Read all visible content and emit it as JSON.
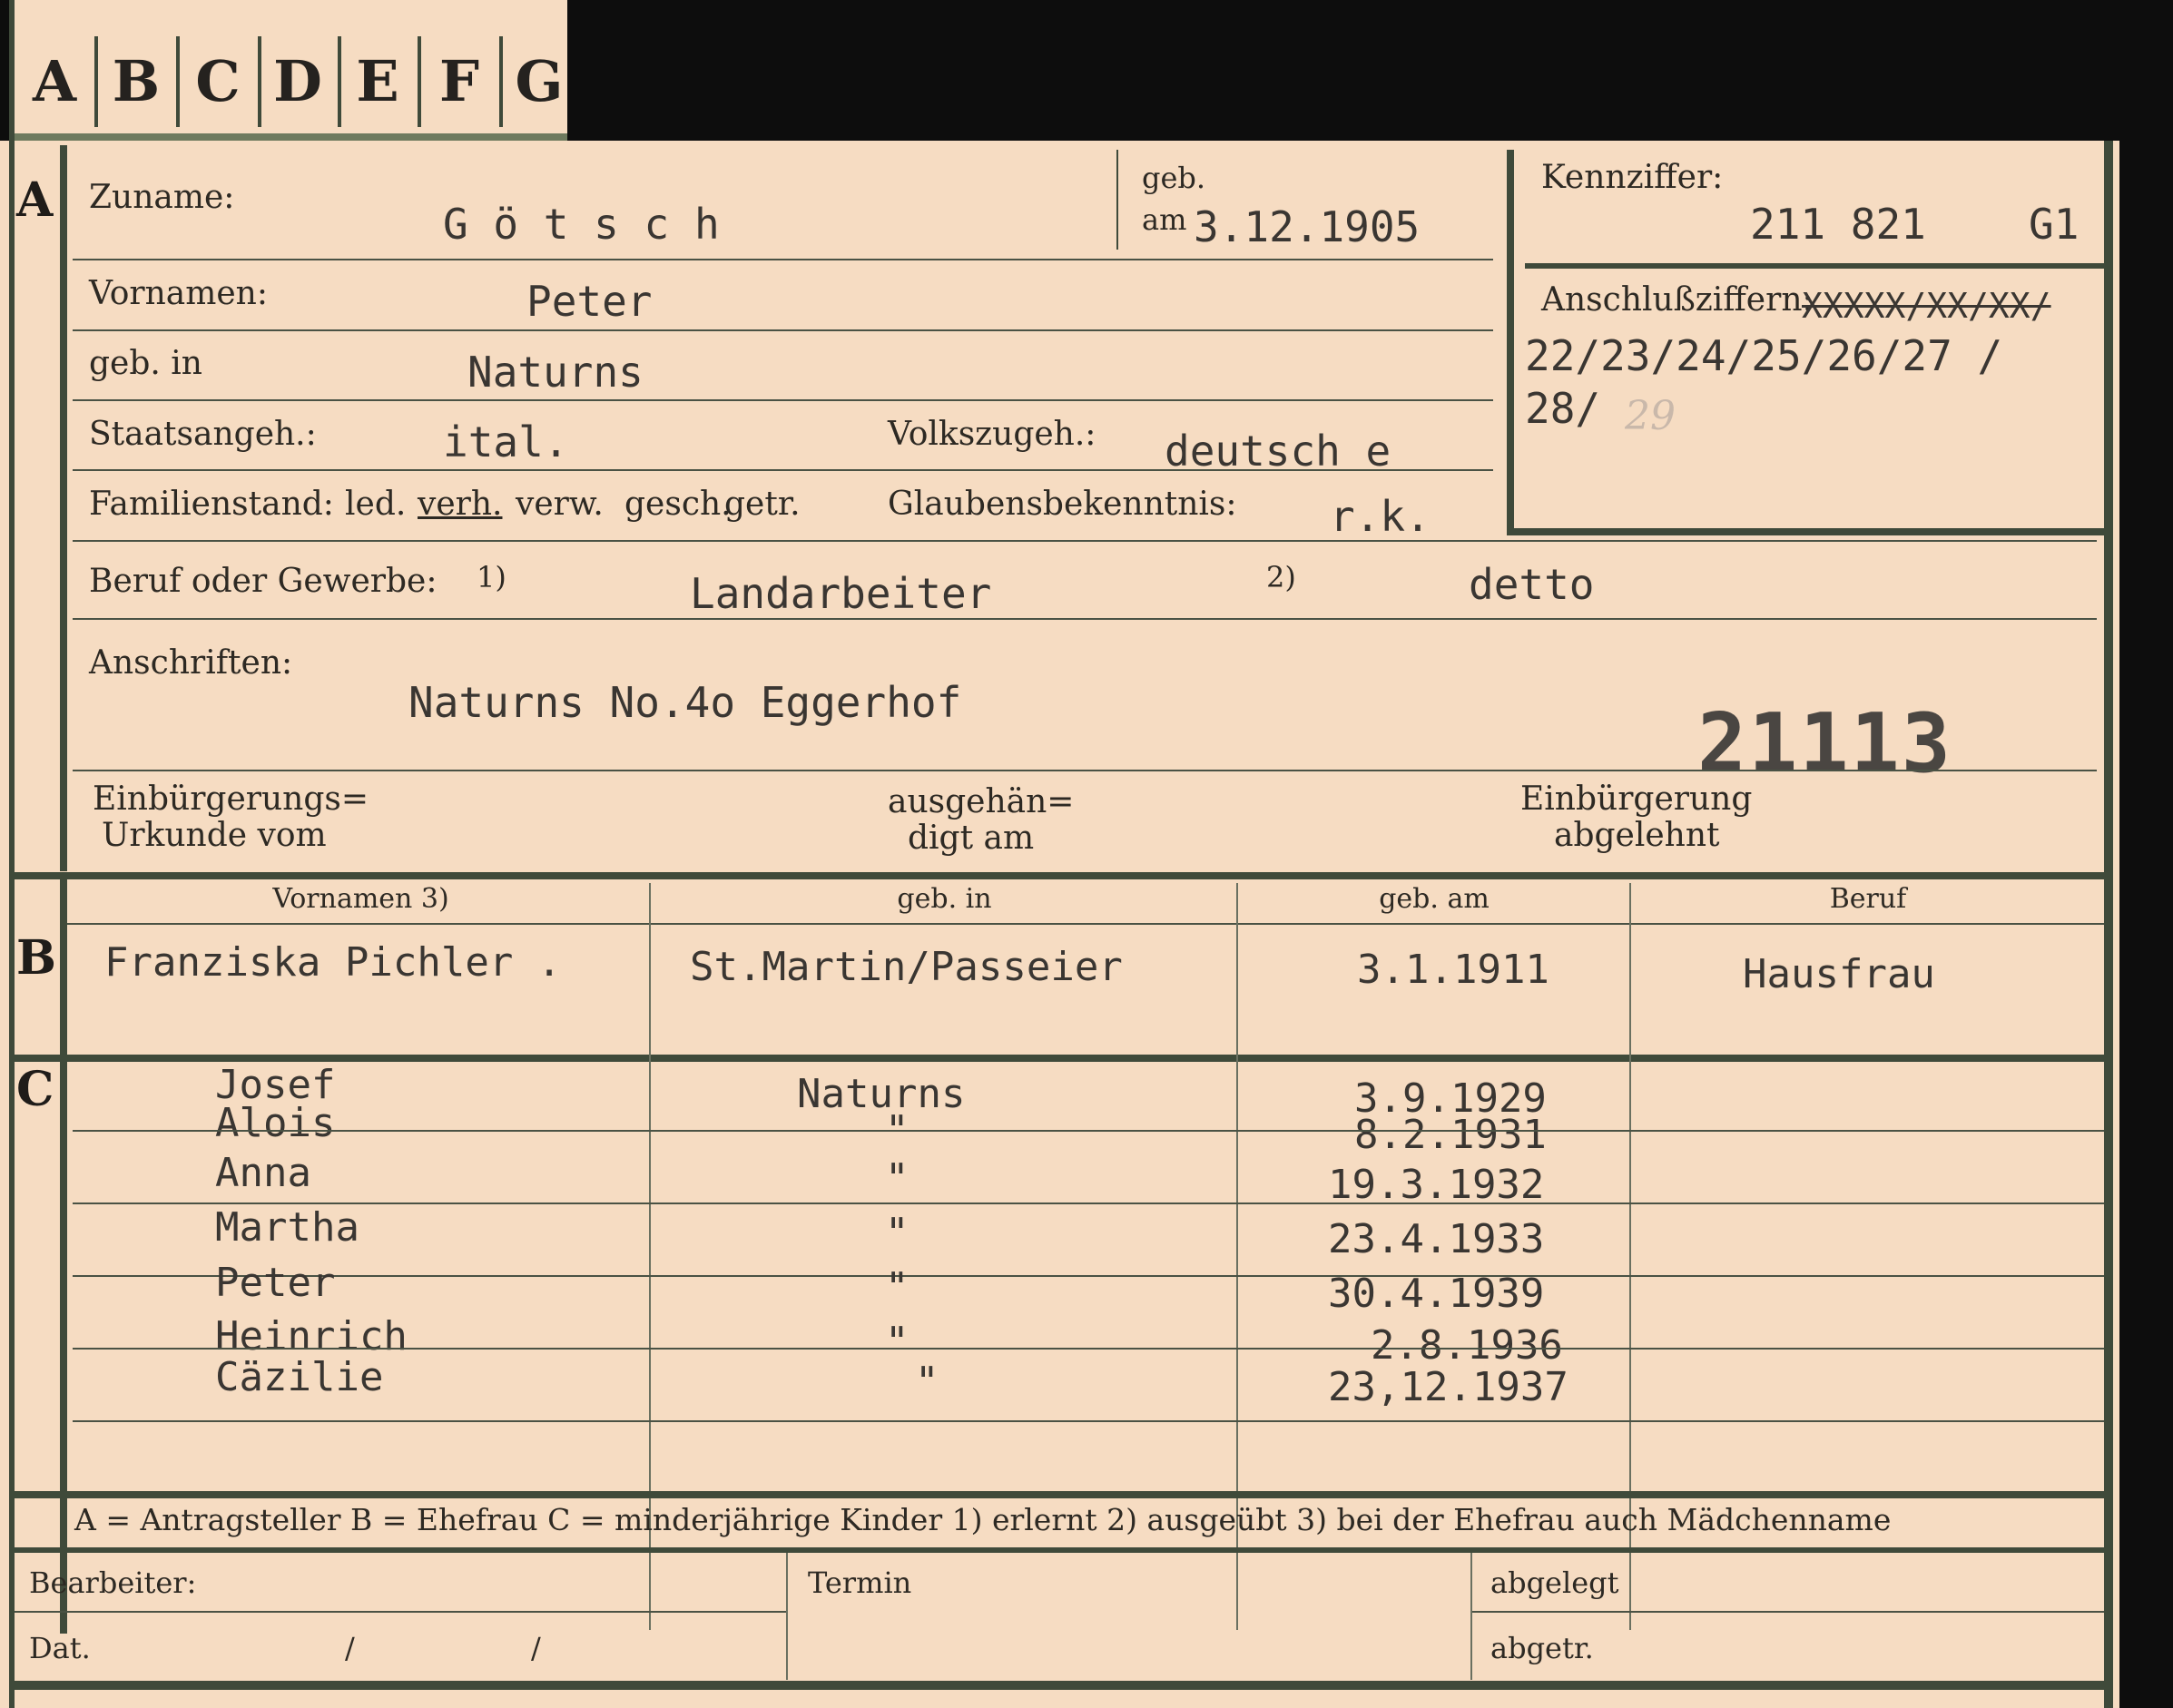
{
  "tabs": [
    "A",
    "B",
    "C",
    "D",
    "E",
    "F",
    "G"
  ],
  "section_a": {
    "marker": "A",
    "zuname_label": "Zuname:",
    "zuname_value": "G ö t s c h",
    "geb_label": "geb.",
    "am_label": "am",
    "geb_am_value": "3.12.1905",
    "kennziffer_label": "Kennziffer:",
    "kennziffer_value": "211 821",
    "kennziffer_suffix": "G1",
    "vornamen_label": "Vornamen:",
    "vornamen_value": "Peter",
    "anschluss_label": "Anschlußziffern:",
    "anschluss_struck": "XXXXX/XX/XX/",
    "anschluss_line1": "22/23/24/25/26/27 /",
    "anschluss_line2": "28/",
    "anschluss_faint": "29",
    "gebin_label": "geb. in",
    "gebin_value": "Naturns",
    "staats_label": "Staatsangeh.:",
    "staats_value": "ital.",
    "volks_label": "Volkszugeh.:",
    "volks_value": "deutsch e",
    "familien_label": "Familienstand:",
    "familien_options": [
      "led.",
      "verh.",
      "verw.",
      "gesch.",
      "getr."
    ],
    "glauben_label": "Glaubensbekenntnis:",
    "glauben_value": "r.k.",
    "beruf_label": "Beruf oder Gewerbe:",
    "beruf_note1": "1)",
    "beruf_value1": "Landarbeiter",
    "beruf_note2": "2)",
    "beruf_value2": "detto",
    "anschriften_label": "Anschriften:",
    "anschriften_value": "Naturns No.4o Eggerhof",
    "stamp_number": "21113",
    "einb_urkunde_line1": "Einbürgerungs=",
    "einb_urkunde_line2": "Urkunde vom",
    "ausgehaen_line1": "ausgehän=",
    "ausgehaen_line2": "digt am",
    "einb_abgelehnt_line1": "Einbürgerung",
    "einb_abgelehnt_line2": "abgelehnt"
  },
  "section_b": {
    "marker": "B",
    "headers": [
      "Vornamen 3)",
      "geb. in",
      "geb. am",
      "Beruf"
    ],
    "row": [
      "Franziska Pichler .",
      "St.Martin/Passeier",
      "3.1.1911",
      "Hausfrau"
    ]
  },
  "section_c": {
    "marker": "C",
    "rows": [
      [
        "Josef",
        "Naturns",
        "3.9.1929"
      ],
      [
        "Alois",
        "\"",
        "8.2.1931"
      ],
      [
        "Anna",
        "\"",
        "19.3.1932"
      ],
      [
        "Martha",
        "\"",
        "23.4.1933"
      ],
      [
        "Peter",
        "\"",
        "30.4.1939"
      ],
      [
        "Heinrich",
        "\"",
        "2.8.1936"
      ],
      [
        "Cäzilie",
        "\"",
        "23,12.1937"
      ]
    ]
  },
  "legend": "A = Antragsteller   B = Ehefrau   C = minderjährige Kinder   1) erlernt   2) ausgeübt   3) bei der Ehefrau auch Mädchenname",
  "footer": {
    "bearbeiter_label": "Bearbeiter:",
    "termin_label": "Termin",
    "abgelegt_label": "abgelegt",
    "dat_label": "Dat.",
    "dat_sep1": "/",
    "dat_sep2": "/",
    "abgetr_label": "abgetr."
  }
}
